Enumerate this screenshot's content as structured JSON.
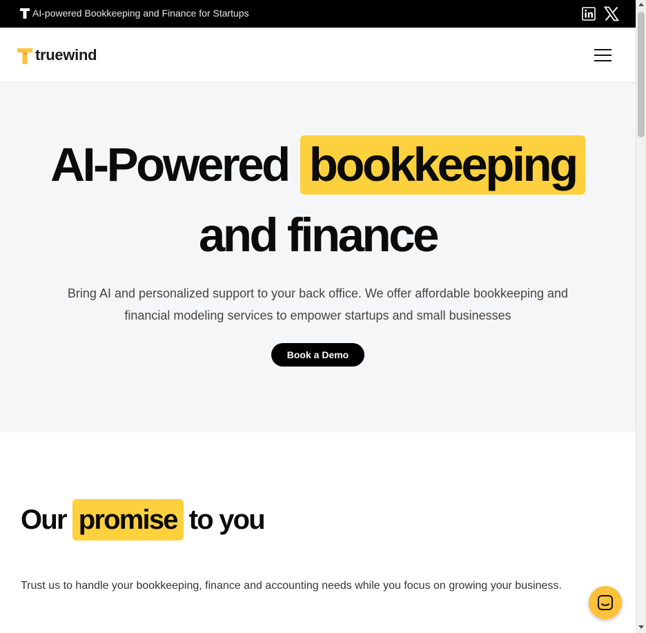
{
  "announcement": {
    "text": "AI-powered Bookkeeping and Finance for Startups",
    "icons": [
      "truewind-t-icon",
      "linkedin-icon",
      "x-twitter-icon"
    ]
  },
  "nav": {
    "logo_text": "truewind",
    "menu_icon": "hamburger-menu-icon"
  },
  "hero": {
    "title_part1": "AI-Powered",
    "title_highlight": "bookkeeping",
    "title_line2": "and finance",
    "subtitle": "Bring AI and personalized support to your back office. We offer affordable bookkeeping and financial modeling services to empower startups and small businesses",
    "cta_label": "Book a Demo"
  },
  "promise": {
    "title_part1": "Our",
    "title_highlight": "promise",
    "title_part2": "to you",
    "text": "Trust us to handle your bookkeeping, finance and accounting needs while you focus on growing your business."
  },
  "chat": {
    "icon": "chat-launcher-icon"
  },
  "colors": {
    "highlight": "#fdd03d",
    "topbar_bg": "#000000",
    "hero_bg": "#f5f6f7",
    "chat_button": "#fdc23a"
  }
}
